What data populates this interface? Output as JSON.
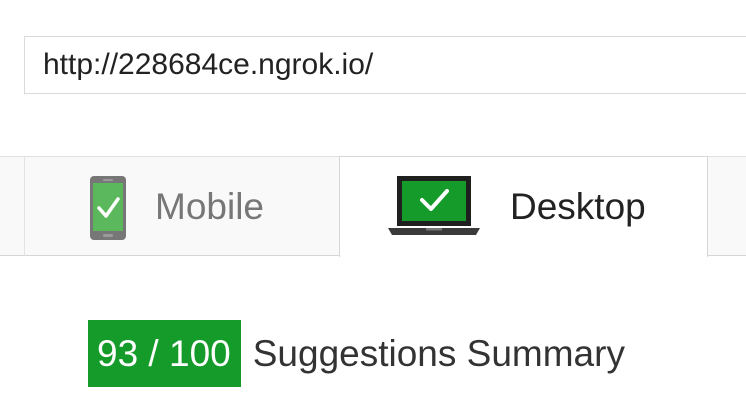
{
  "url_field": {
    "value": "http://228684ce.ngrok.io/"
  },
  "tabs": [
    {
      "label": "Mobile",
      "icon": "mobile-check-icon",
      "selected": false
    },
    {
      "label": "Desktop",
      "icon": "desktop-check-icon",
      "selected": true
    }
  ],
  "score": {
    "value": "93 / 100",
    "label": "Suggestions Summary",
    "color": "#159b29"
  },
  "colors": {
    "good_green": "#159b29",
    "phone_green": "#4caf50",
    "inactive_text": "#777777",
    "active_text": "#222222"
  }
}
